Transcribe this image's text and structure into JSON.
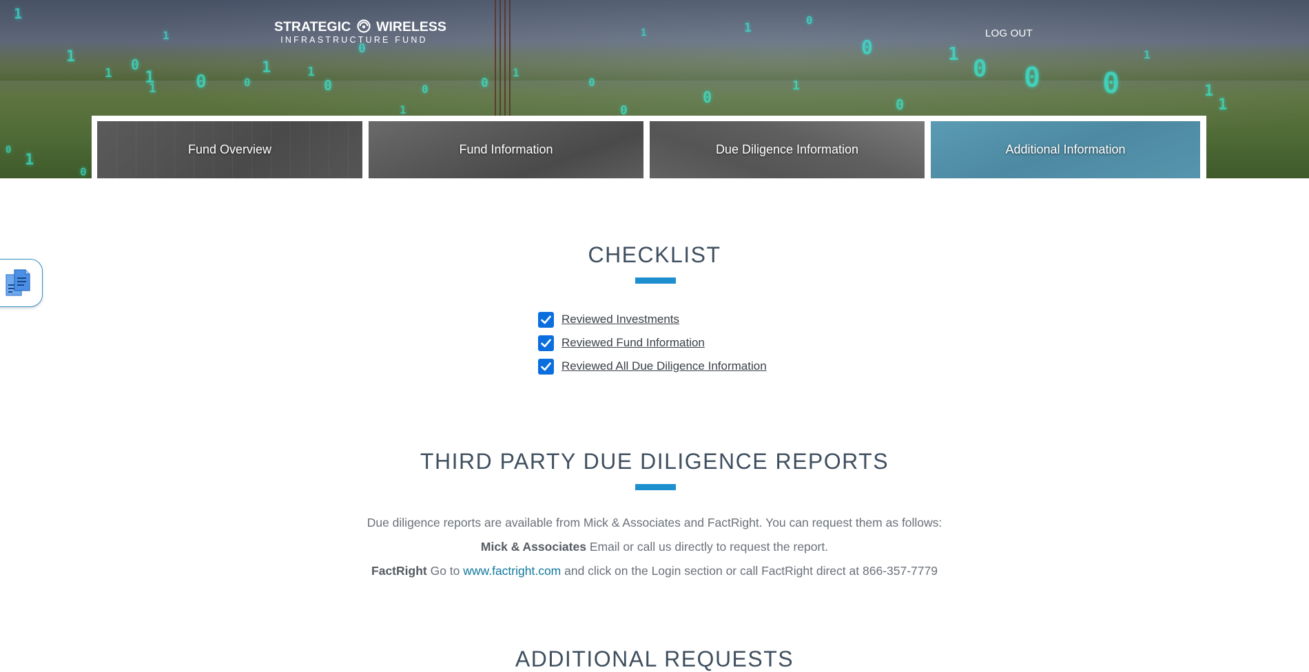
{
  "brand": {
    "line1_left": "STRATEGIC",
    "line1_right": "WIRELESS",
    "line2": "INFRASTRUCTURE FUND"
  },
  "header": {
    "logout_label": "LOG OUT"
  },
  "nav": {
    "tabs": [
      {
        "label": "Fund Overview",
        "active": false
      },
      {
        "label": "Fund Information",
        "active": false
      },
      {
        "label": "Due Diligence Information",
        "active": false
      },
      {
        "label": "Additional Information",
        "active": true
      }
    ]
  },
  "floating_button": {
    "icon": "documents-icon"
  },
  "checklist": {
    "title": "CHECKLIST",
    "items": [
      {
        "label": "Reviewed Investments",
        "checked": true
      },
      {
        "label": "Reviewed Fund Information",
        "checked": true
      },
      {
        "label": "Reviewed All Due Diligence Information",
        "checked": true
      }
    ]
  },
  "reports": {
    "title": "THIRD PARTY DUE DILIGENCE REPORTS",
    "intro": "Due diligence reports are available from Mick & Associates and FactRight. You can request them as follows:",
    "mick_name": "Mick & Associates",
    "mick_text": " Email or call us directly to request the report.",
    "factright_name": "FactRight",
    "factright_pre": " Go to ",
    "factright_link": "www.factright.com",
    "factright_post": " and click on the Login section or call FactRight direct at 866-357-7779"
  },
  "additional": {
    "title": "ADDITIONAL REQUESTS"
  },
  "colors": {
    "accent_bar": "#1d8fce",
    "active_tab": "#4d89a2",
    "checkbox": "#0b6ede",
    "link": "#12799e"
  }
}
